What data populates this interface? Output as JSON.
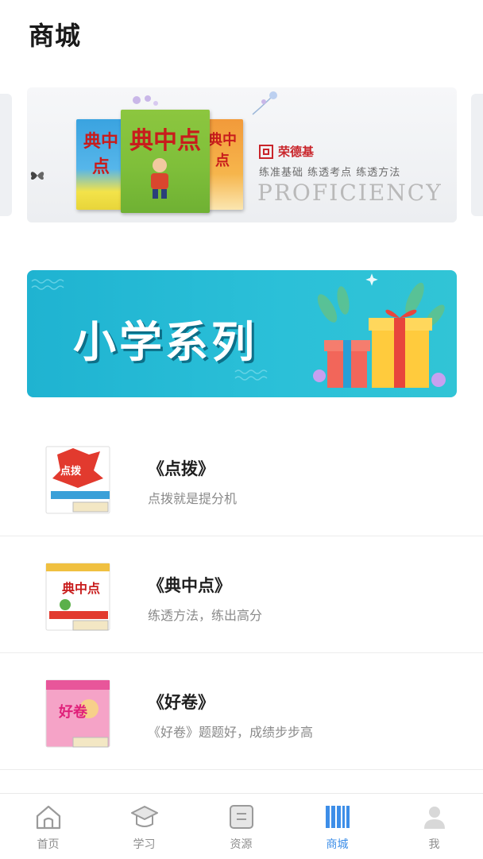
{
  "header": {
    "title": "商城"
  },
  "banner": {
    "brand_name": "荣德基",
    "brand_tagline": "练准基础 练透考点 练透方法",
    "brand_english": "PROFICIENCY",
    "book_title": "典中点"
  },
  "section": {
    "title": "小学系列"
  },
  "products": [
    {
      "name": "《点拨》",
      "desc": "点拨就是提分机",
      "cover_text": "点拨"
    },
    {
      "name": "《典中点》",
      "desc": "练透方法，练出高分",
      "cover_text": "典中点"
    },
    {
      "name": "《好卷》",
      "desc": "《好卷》题题好，成绩步步高",
      "cover_text": "好卷"
    }
  ],
  "tabbar": {
    "tabs": [
      {
        "label": "首页",
        "icon": "home-icon"
      },
      {
        "label": "学习",
        "icon": "graduation-cap-icon"
      },
      {
        "label": "资源",
        "icon": "resource-icon"
      },
      {
        "label": "商城",
        "icon": "bookshelf-icon",
        "active": true
      },
      {
        "label": "我",
        "icon": "user-icon"
      }
    ],
    "active_color": "#3d8ee8",
    "inactive_color": "#8e8e8e"
  }
}
